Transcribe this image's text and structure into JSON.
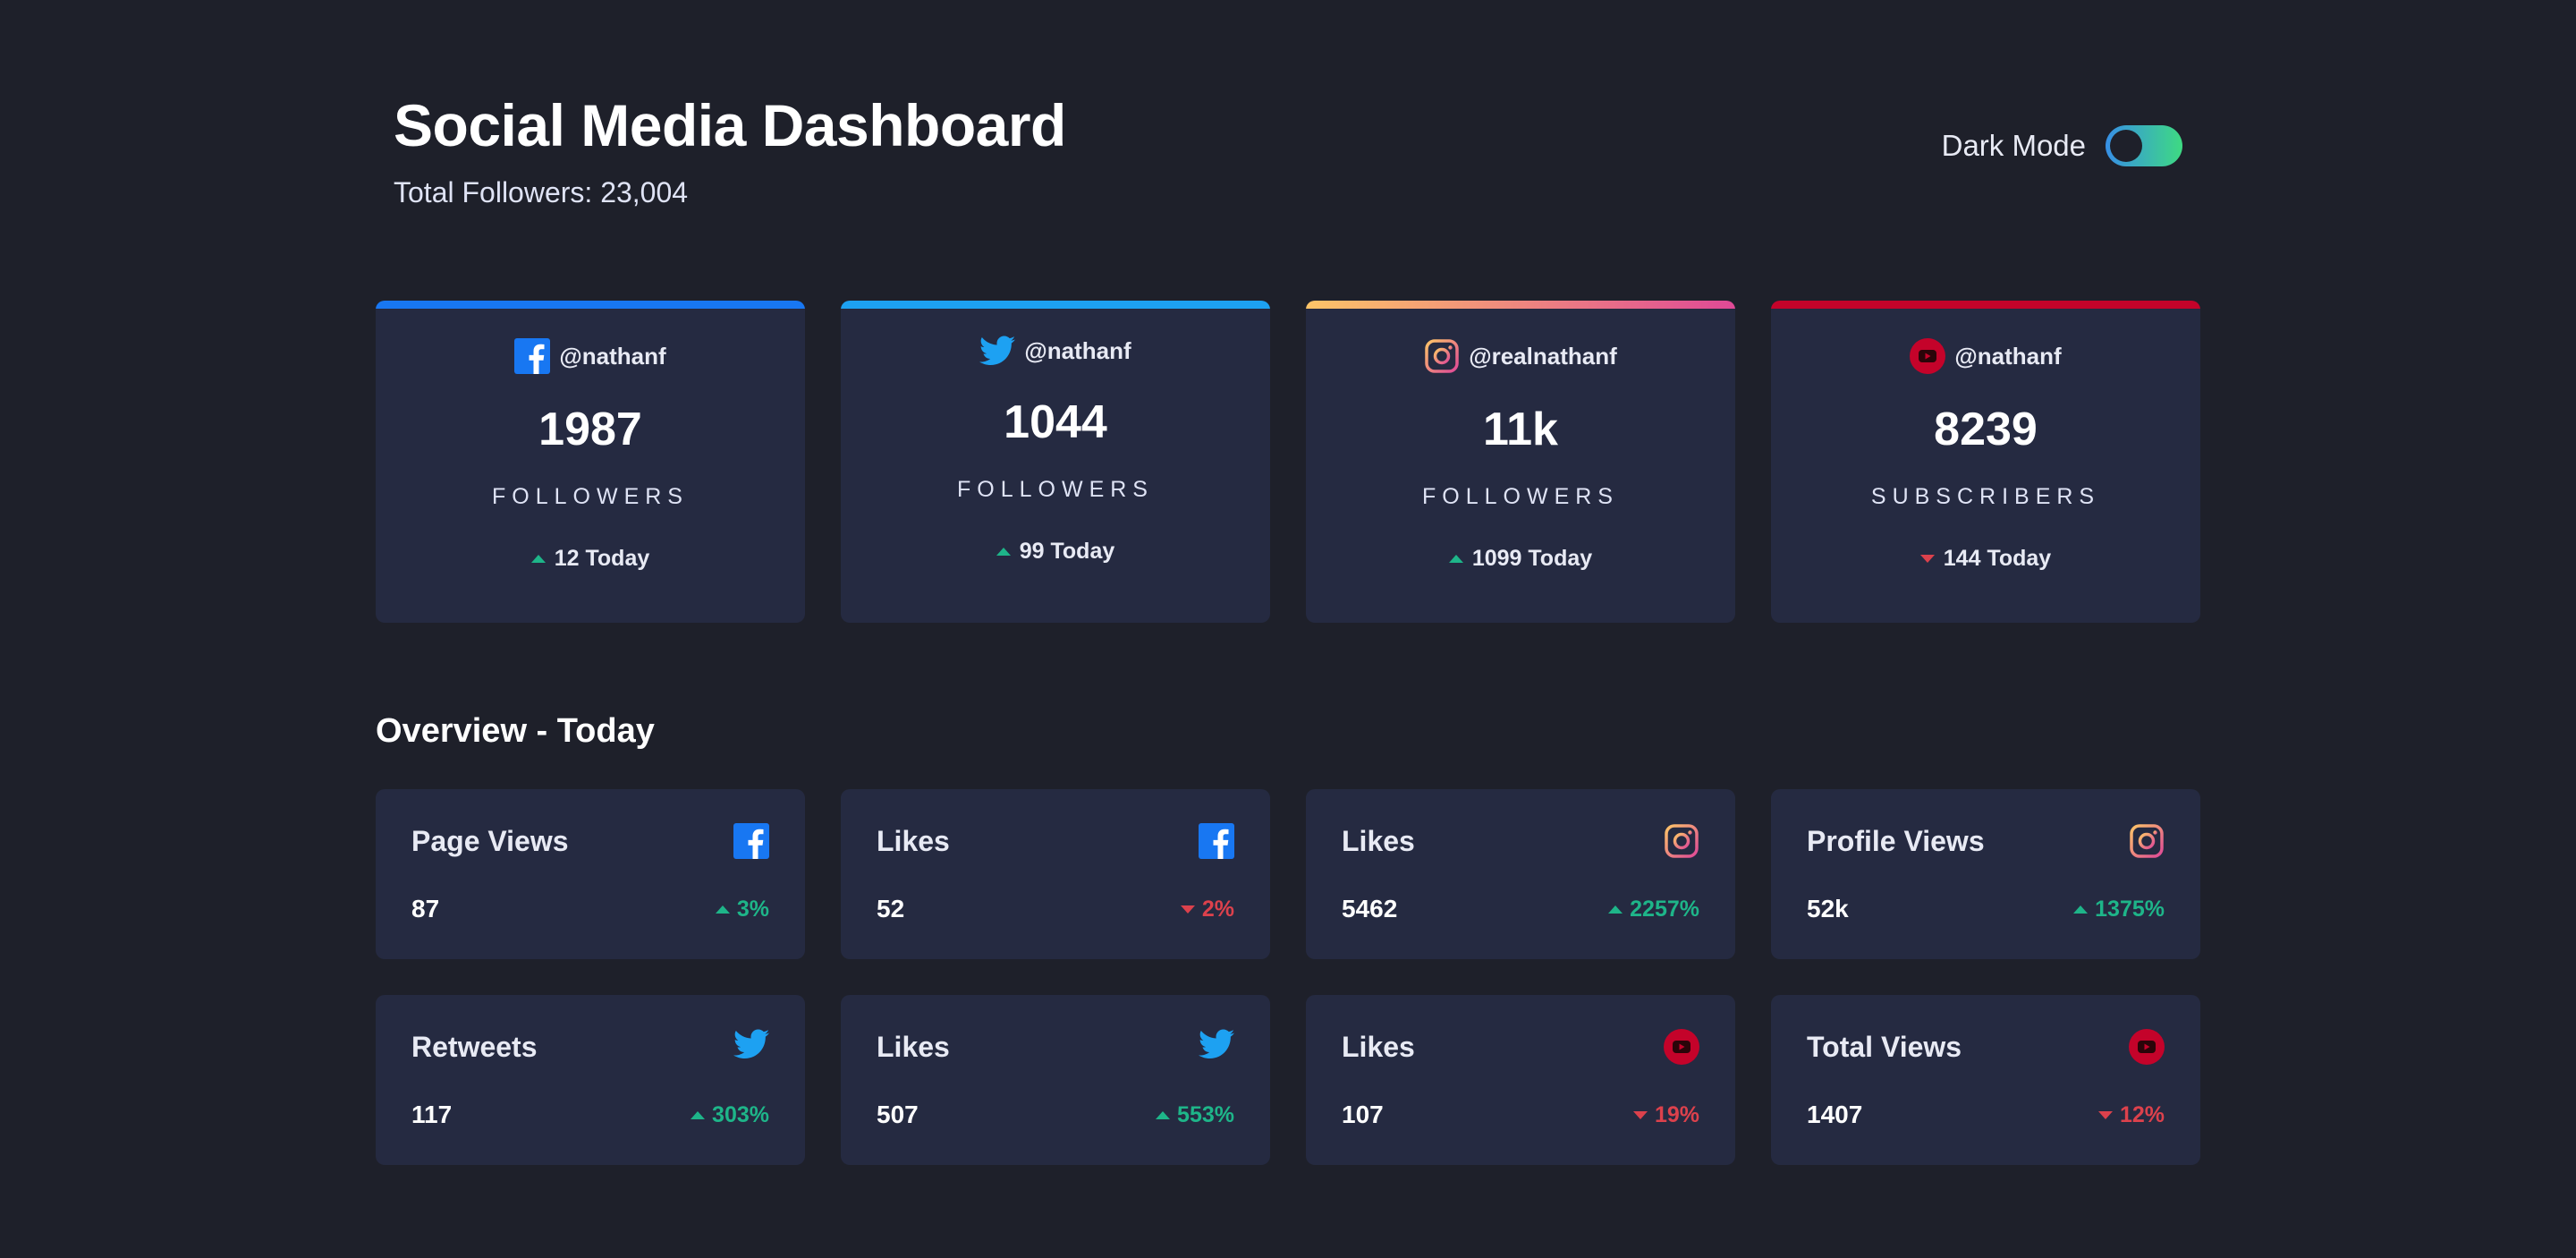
{
  "header": {
    "title": "Social Media Dashboard",
    "total_followers": "Total Followers: 23,004"
  },
  "toggle": {
    "label": "Dark Mode",
    "state": "on"
  },
  "colors": {
    "facebook": "#1877f2",
    "twitter": "#1da1f2",
    "instagram_from": "#fdc468",
    "instagram_to": "#df4996",
    "youtube": "#c4032a",
    "up": "#1eb589",
    "down": "#dc414c"
  },
  "cards": [
    {
      "network": "facebook",
      "icon": "facebook-icon",
      "handle": "@nathanf",
      "count": "1987",
      "label": "FOLLOWERS",
      "today": "12 Today",
      "trend": "up"
    },
    {
      "network": "twitter",
      "icon": "twitter-icon",
      "handle": "@nathanf",
      "count": "1044",
      "label": "FOLLOWERS",
      "today": "99 Today",
      "trend": "up"
    },
    {
      "network": "instagram",
      "icon": "instagram-icon",
      "handle": "@realnathanf",
      "count": "11k",
      "label": "FOLLOWERS",
      "today": "1099 Today",
      "trend": "up"
    },
    {
      "network": "youtube",
      "icon": "youtube-icon",
      "handle": "@nathanf",
      "count": "8239",
      "label": "SUBSCRIBERS",
      "today": "144 Today",
      "trend": "down"
    }
  ],
  "overview": {
    "title": "Overview - Today",
    "items": [
      {
        "label": "Page Views",
        "network": "facebook",
        "value": "87",
        "change": "3%",
        "trend": "up"
      },
      {
        "label": "Likes",
        "network": "facebook",
        "value": "52",
        "change": "2%",
        "trend": "down"
      },
      {
        "label": "Likes",
        "network": "instagram",
        "value": "5462",
        "change": "2257%",
        "trend": "up"
      },
      {
        "label": "Profile Views",
        "network": "instagram",
        "value": "52k",
        "change": "1375%",
        "trend": "up"
      },
      {
        "label": "Retweets",
        "network": "twitter",
        "value": "117",
        "change": "303%",
        "trend": "up"
      },
      {
        "label": "Likes",
        "network": "twitter",
        "value": "507",
        "change": "553%",
        "trend": "up"
      },
      {
        "label": "Likes",
        "network": "youtube",
        "value": "107",
        "change": "19%",
        "trend": "down"
      },
      {
        "label": "Total Views",
        "network": "youtube",
        "value": "1407",
        "change": "12%",
        "trend": "down"
      }
    ]
  }
}
